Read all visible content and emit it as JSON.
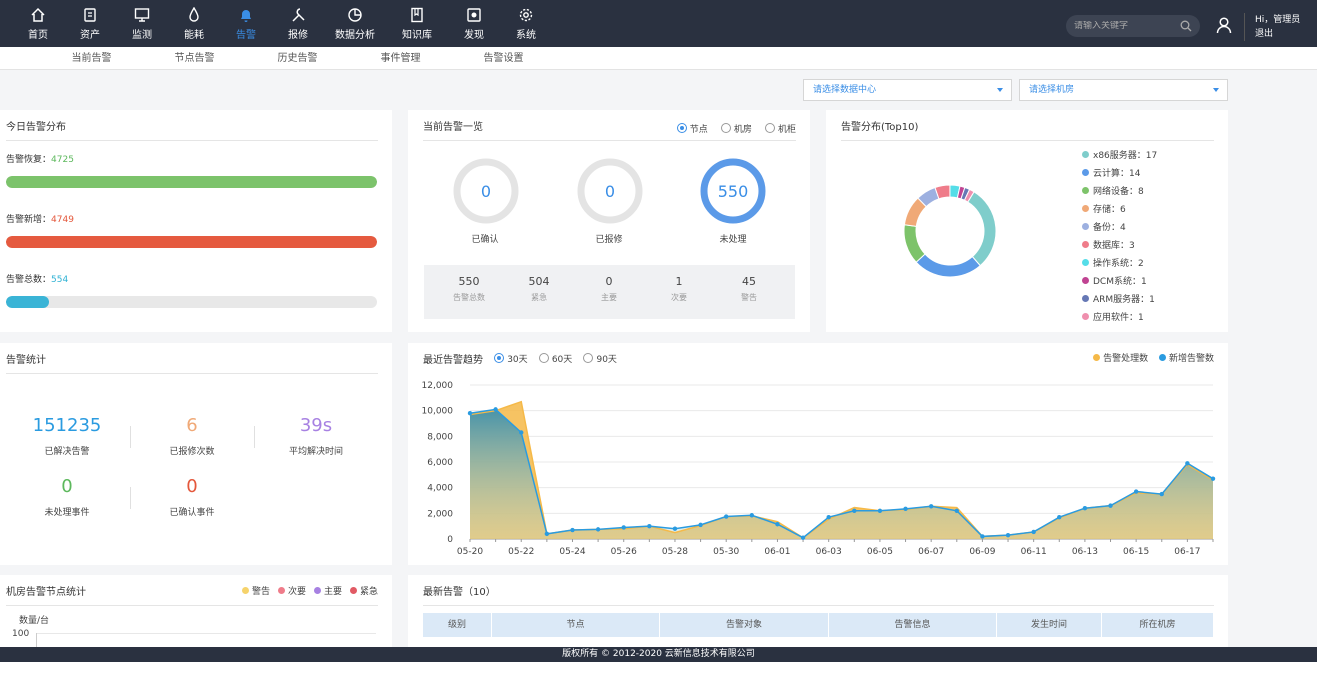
{
  "nav": {
    "items": [
      {
        "label": "首页",
        "icon": "home-icon"
      },
      {
        "label": "资产",
        "icon": "asset-icon"
      },
      {
        "label": "监测",
        "icon": "monitor-icon"
      },
      {
        "label": "能耗",
        "icon": "energy-icon"
      },
      {
        "label": "告警",
        "icon": "bell-icon"
      },
      {
        "label": "报修",
        "icon": "wrench-icon"
      },
      {
        "label": "数据分析",
        "icon": "pie-icon"
      },
      {
        "label": "知识库",
        "icon": "book-icon"
      },
      {
        "label": "发现",
        "icon": "discover-icon"
      },
      {
        "label": "系统",
        "icon": "gear-icon"
      }
    ],
    "active_index": 4,
    "search_placeholder": "请输入关键字",
    "greeting": "Hi，管理员",
    "logout": "退出"
  },
  "subnav": [
    "当前告警",
    "节点告警",
    "历史告警",
    "事件管理",
    "告警设置"
  ],
  "filters": {
    "datacenter": "请选择数据中心",
    "room": "请选择机房"
  },
  "today": {
    "title": "今日告警分布",
    "rows": [
      {
        "label": "告警恢复：",
        "value": "4725",
        "color": "#5cb85c",
        "fill": "#7cc36b",
        "ratio": 1.0
      },
      {
        "label": "告警新增：",
        "value": "4749",
        "color": "#e4573b",
        "fill": "#e55a3f",
        "ratio": 1.0
      },
      {
        "label": "告警总数：",
        "value": "554",
        "color": "#2fb2d4",
        "fill": "#3ab4d6",
        "ratio": 0.117
      }
    ]
  },
  "overview": {
    "title": "当前告警一览",
    "radios": [
      {
        "label": "节点",
        "on": true
      },
      {
        "label": "机房",
        "on": false
      },
      {
        "label": "机柜",
        "on": false
      }
    ],
    "rings": [
      {
        "value": "0",
        "label": "已确认",
        "ratio": 0
      },
      {
        "value": "0",
        "label": "已报修",
        "ratio": 0
      },
      {
        "value": "550",
        "label": "未处理",
        "ratio": 1
      }
    ],
    "summary": [
      {
        "value": "550",
        "label": "告警总数"
      },
      {
        "value": "504",
        "label": "紧急"
      },
      {
        "value": "0",
        "label": "主要"
      },
      {
        "value": "1",
        "label": "次要"
      },
      {
        "value": "45",
        "label": "警告"
      }
    ]
  },
  "distribution": {
    "title": "告警分布(Top10)",
    "items": [
      {
        "label": "x86服务器：17",
        "value": 17,
        "color": "#7fcdcb"
      },
      {
        "label": "云计算：14",
        "value": 14,
        "color": "#5b9ae8"
      },
      {
        "label": "网络设备：8",
        "value": 8,
        "color": "#7dc36a"
      },
      {
        "label": "存储：6",
        "value": 6,
        "color": "#f0a977"
      },
      {
        "label": "备份：4",
        "value": 4,
        "color": "#9db0e0"
      },
      {
        "label": "数据库：3",
        "value": 3,
        "color": "#ef7c8a"
      },
      {
        "label": "操作系统：2",
        "value": 2,
        "color": "#55dde8"
      },
      {
        "label": "DCM系统：1",
        "value": 1,
        "color": "#c04392"
      },
      {
        "label": "ARM服务器：1",
        "value": 1,
        "color": "#6678b5"
      },
      {
        "label": "应用软件：1",
        "value": 1,
        "color": "#ef8fae"
      }
    ]
  },
  "stats": {
    "title": "告警统计",
    "items": [
      {
        "value": "151235",
        "label": "已解决告警",
        "color": "#2a9be0"
      },
      {
        "value": "6",
        "label": "已报修次数",
        "color": "#f0a977"
      },
      {
        "value": "39s",
        "label": "平均解决时间",
        "color": "#a781e2"
      },
      {
        "value": "0",
        "label": "未处理事件",
        "color": "#5cb85c"
      },
      {
        "value": "0",
        "label": "已确认事件",
        "color": "#e4573b"
      }
    ]
  },
  "trend": {
    "title": "最近告警趋势",
    "radios": [
      {
        "label": "30天",
        "on": true
      },
      {
        "label": "60天",
        "on": false
      },
      {
        "label": "90天",
        "on": false
      }
    ]
  },
  "chart_data": {
    "type": "area",
    "x": [
      "05-20",
      "05-21",
      "05-22",
      "05-23",
      "05-24",
      "05-25",
      "05-26",
      "05-27",
      "05-28",
      "05-29",
      "05-30",
      "05-31",
      "06-01",
      "06-02",
      "06-03",
      "06-04",
      "06-05",
      "06-06",
      "06-07",
      "06-08",
      "06-09",
      "06-10",
      "06-11",
      "06-12",
      "06-13",
      "06-14",
      "06-15",
      "06-16",
      "06-17",
      "06-18"
    ],
    "xticks": [
      "05-20",
      "05-22",
      "05-24",
      "05-26",
      "05-28",
      "05-30",
      "06-01",
      "06-03",
      "06-05",
      "06-07",
      "06-09",
      "06-11",
      "06-13",
      "06-15",
      "06-17"
    ],
    "yticks": [
      "0",
      "2,000",
      "4,000",
      "6,000",
      "8,000",
      "10,000",
      "12,000"
    ],
    "ylim": [
      0,
      12000
    ],
    "series": [
      {
        "name": "告警处理数",
        "color": "#f5b948",
        "values": [
          9700,
          10000,
          10700,
          400,
          700,
          750,
          800,
          1000,
          500,
          1050,
          1750,
          1800,
          1350,
          100,
          1550,
          2450,
          2200,
          2300,
          2550,
          2450,
          200,
          300,
          550,
          1650,
          2400,
          2600,
          3600,
          3500,
          5800,
          4600
        ]
      },
      {
        "name": "新增告警数",
        "color": "#2a9be0",
        "values": [
          9800,
          10100,
          8300,
          400,
          700,
          750,
          900,
          1000,
          800,
          1100,
          1750,
          1850,
          1150,
          100,
          1700,
          2200,
          2200,
          2350,
          2550,
          2200,
          200,
          300,
          550,
          1700,
          2400,
          2600,
          3700,
          3500,
          5900,
          4700
        ]
      }
    ]
  },
  "nodes": {
    "title": "机房告警节点统计",
    "legend": [
      {
        "label": "警告",
        "color": "#f6d36b"
      },
      {
        "label": "次要",
        "color": "#ef7c8a"
      },
      {
        "label": "主要",
        "color": "#a781e2"
      },
      {
        "label": "紧急",
        "color": "#e15a64"
      }
    ],
    "unit": "数量/台",
    "ytop": "100"
  },
  "latest": {
    "title": "最新告警（10）",
    "columns": [
      "级别",
      "节点",
      "告警对象",
      "告警信息",
      "发生时间",
      "所在机房"
    ]
  },
  "footer": "版权所有 © 2012-2020 云新信息技术有限公司"
}
